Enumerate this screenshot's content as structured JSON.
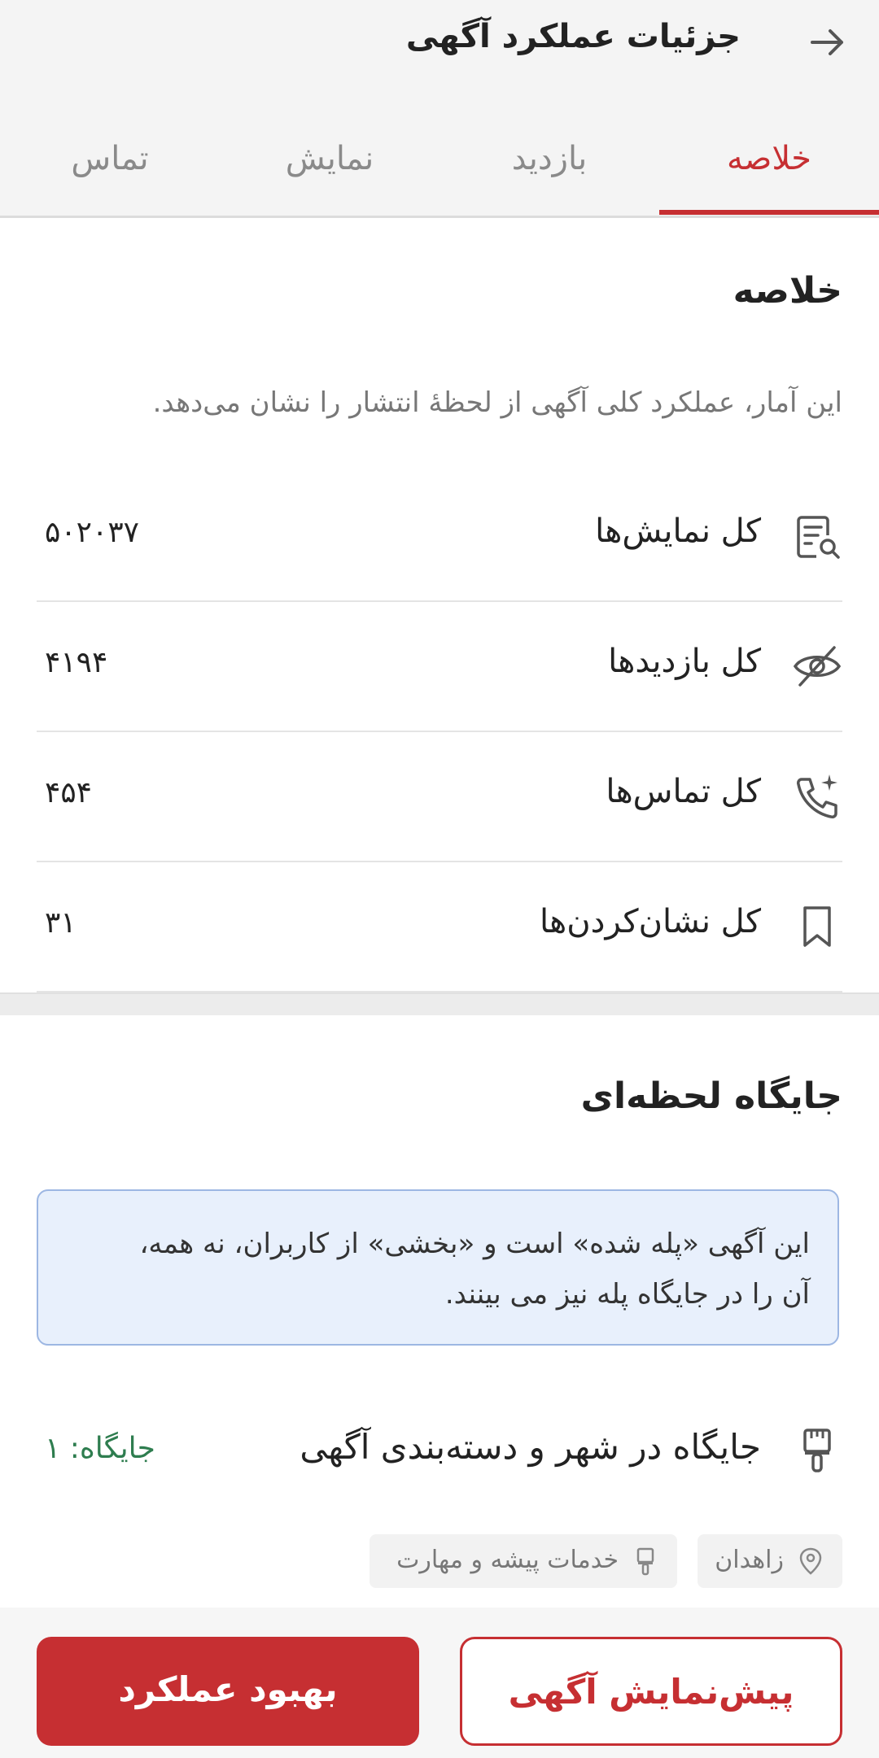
{
  "header": {
    "title": "جزئیات عملکرد آگهی",
    "tabs": [
      "خلاصه",
      "بازدید",
      "نمایش",
      "تماس"
    ]
  },
  "summary": {
    "heading": "خلاصه",
    "description": "این آمار، عملکرد کلی آگهی از لحظهٔ انتشار را نشان می‌دهد.",
    "rows": [
      {
        "label": "کل نمایش‌ها",
        "value": "۵۰۲۰۳۷",
        "icon": "document-search-icon"
      },
      {
        "label": "کل بازدیدها",
        "value": "۴۱۹۴",
        "icon": "eye-off-icon"
      },
      {
        "label": "کل تماس‌ها",
        "value": "۴۵۴",
        "icon": "phone-sparkle-icon"
      },
      {
        "label": "کل نشان‌کردن‌ها",
        "value": "۳۱",
        "icon": "bookmark-icon"
      }
    ]
  },
  "ranking": {
    "heading": "جایگاه لحظه‌ای",
    "info_line1": "این آگهی «پله شده» است و «بخشی» از کاربران، نه همه،",
    "info_line2": "آن را در جایگاه پله نیز می بینند.",
    "row_label": "جایگاه در شهر و دسته‌بندی آگهی",
    "row_value": "جایگاه: ۱",
    "chips": {
      "city": "زاهدان",
      "category": "خدمات پیشه و مهارت"
    }
  },
  "actions": {
    "preview": "پیش‌نمایش آگهی",
    "improve": "بهبود عملکرد"
  },
  "colors": {
    "accent": "#c62f32",
    "rank_green": "#2e7d4f",
    "info_bg": "#e8f0fc"
  }
}
